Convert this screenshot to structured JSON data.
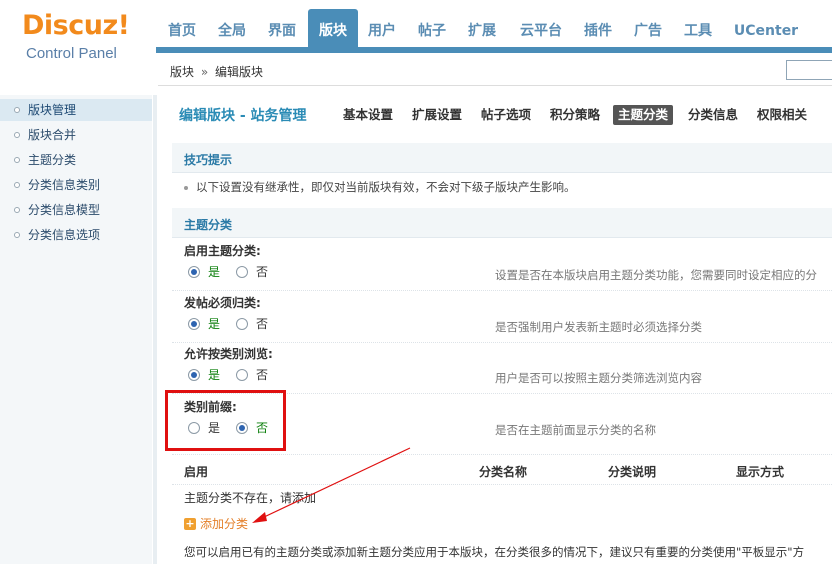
{
  "logo": {
    "brand": "Discuz!",
    "subtitle": "Control Panel"
  },
  "nav": {
    "tabs": [
      "首页",
      "全局",
      "界面",
      "版块",
      "用户",
      "帖子",
      "扩展",
      "云平台",
      "插件",
      "广告",
      "工具",
      "UCenter"
    ],
    "active": "版块"
  },
  "breadcrumb": {
    "parent": "版块",
    "separator": "»",
    "current": "编辑版块"
  },
  "sidebar": {
    "items": [
      "版块管理",
      "版块合并",
      "主题分类",
      "分类信息类别",
      "分类信息模型",
      "分类信息选项"
    ],
    "active": "版块管理"
  },
  "main": {
    "heading": "编辑版块 - 站务管理",
    "subtabs": [
      "基本设置",
      "扩展设置",
      "帖子选项",
      "积分策略",
      "主题分类",
      "分类信息",
      "权限相关"
    ],
    "active_subtab": "主题分类",
    "tips_title": "技巧提示",
    "tip": "以下设置没有继承性，即仅对当前版块有效，不会对下级子版块产生影响。",
    "section_title": "主题分类",
    "settings": [
      {
        "label": "启用主题分类:",
        "yes": "是",
        "no": "否",
        "value": "是",
        "desc": "设置是否在本版块启用主题分类功能，您需要同时设定相应的分"
      },
      {
        "label": "发帖必须归类:",
        "yes": "是",
        "no": "否",
        "value": "是",
        "desc": "是否强制用户发表新主题时必须选择分类"
      },
      {
        "label": "允许按类别浏览:",
        "yes": "是",
        "no": "否",
        "value": "是",
        "desc": "用户是否可以按照主题分类筛选浏览内容"
      },
      {
        "label": "类别前缀:",
        "yes": "是",
        "no": "否",
        "value": "否",
        "desc": "是否在主题前面显示分类的名称"
      }
    ],
    "table": {
      "columns": [
        "启用",
        "分类名称",
        "分类说明",
        "显示方式"
      ],
      "empty": "主题分类不存在，请添加",
      "add_label": "添加分类"
    },
    "footer_text": "您可以启用已有的主题分类或添加新主题分类应用于本版块，在分类很多的情况下，建议只有重要的分类使用\"平板显示\"方"
  },
  "colors": {
    "accent": "#4a8db8",
    "highlight": "#e01010",
    "link": "#e4802a",
    "checked": "#0a7e0a"
  }
}
